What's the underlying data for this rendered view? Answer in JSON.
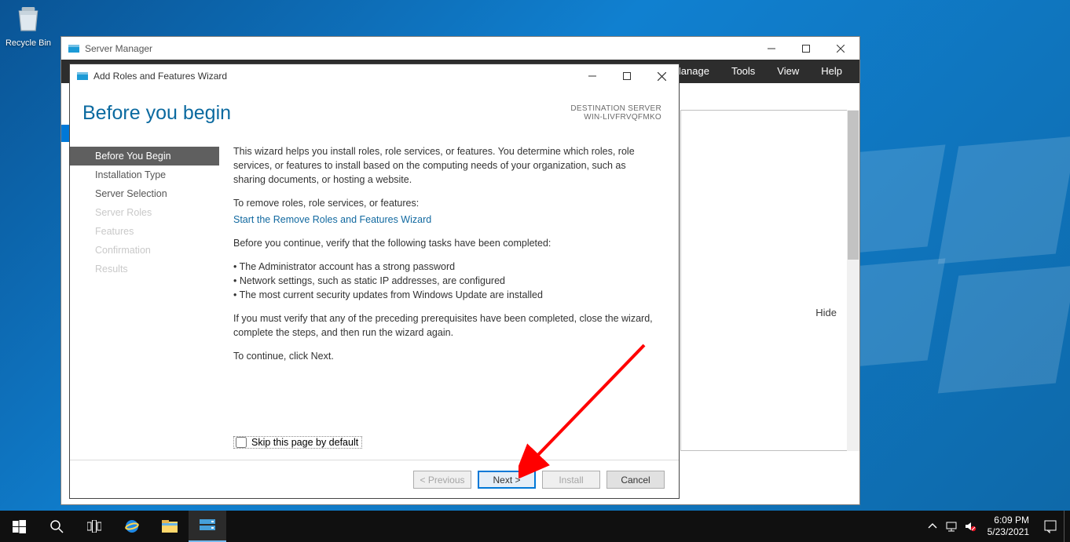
{
  "desktop": {
    "recycle_bin": "Recycle Bin"
  },
  "server_manager": {
    "title": "Server Manager",
    "menus": [
      "Manage",
      "Tools",
      "View",
      "Help"
    ],
    "hide": "Hide"
  },
  "wizard": {
    "title": "Add Roles and Features Wizard",
    "heading": "Before you begin",
    "destination_label": "DESTINATION SERVER",
    "destination_value": "WIN-LIVFRVQFMKO",
    "steps": [
      {
        "label": "Before You Begin",
        "state": "active"
      },
      {
        "label": "Installation Type",
        "state": "normal"
      },
      {
        "label": "Server Selection",
        "state": "normal"
      },
      {
        "label": "Server Roles",
        "state": "disabled"
      },
      {
        "label": "Features",
        "state": "disabled"
      },
      {
        "label": "Confirmation",
        "state": "disabled"
      },
      {
        "label": "Results",
        "state": "disabled"
      }
    ],
    "content": {
      "intro": "This wizard helps you install roles, role services, or features. You determine which roles, role services, or features to install based on the computing needs of your organization, such as sharing documents, or hosting a website.",
      "remove_label": "To remove roles, role services, or features:",
      "remove_link": "Start the Remove Roles and Features Wizard",
      "verify_intro": "Before you continue, verify that the following tasks have been completed:",
      "bullets": [
        "The Administrator account has a strong password",
        "Network settings, such as static IP addresses, are configured",
        "The most current security updates from Windows Update are installed"
      ],
      "verify_close": "If you must verify that any of the preceding prerequisites have been completed, close the wizard, complete the steps, and then run the wizard again.",
      "continue": "To continue, click Next."
    },
    "skip_label": "Skip this page by default",
    "buttons": {
      "previous": "< Previous",
      "next": "Next >",
      "install": "Install",
      "cancel": "Cancel"
    }
  },
  "taskbar": {
    "time": "6:09 PM",
    "date": "5/23/2021"
  }
}
